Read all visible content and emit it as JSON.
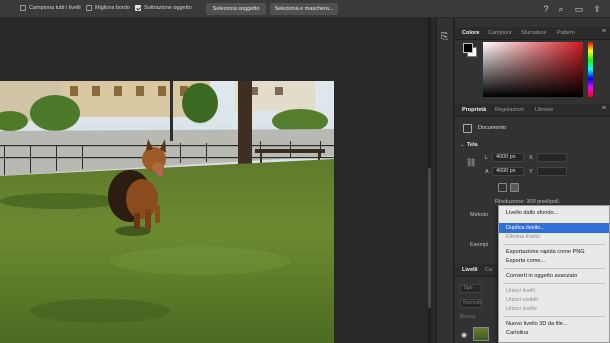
{
  "options_bar": {
    "sample_all_layers": "Campiona tutti i livelli",
    "enhance_edge": "Migliora bordo",
    "subtract_object": "Sottrazione oggetto",
    "select_subject": "Seleziona soggetto",
    "select_and_mask": "Seleziona e maschera..."
  },
  "color_panel": {
    "tabs": [
      "Colore",
      "Campioni",
      "Sfumature",
      "Pattern"
    ],
    "foreground": "#000000",
    "background": "#ffffff",
    "hue_color": "#d01a20"
  },
  "properties_panel": {
    "tabs": [
      "Proprietà",
      "Regolazioni",
      "Librerie"
    ],
    "document_label": "Documento",
    "canvas_section": "Tela",
    "width_label": "L",
    "width_value": "4000 px",
    "height_label": "A",
    "height_value": "4000 px",
    "x_label": "X",
    "y_label": "Y",
    "resolution": "Risoluzione: 300 pixel/poll.",
    "mode_label": "Metodo",
    "examples_label": "Esempi"
  },
  "layers_panel": {
    "tabs": [
      "Livelli",
      "Ca"
    ],
    "search_kind": "Tipo",
    "blend_mode": "Normale",
    "lock_label": "Blocca"
  },
  "context_menu": {
    "items": [
      {
        "label": "Livello dallo sfondo...",
        "state": "normal"
      },
      {
        "label": "Duplica livello...",
        "state": "highlighted"
      },
      {
        "label": "Elimina livello",
        "state": "disabled"
      },
      {
        "label": "Esportazione rapida come PNG",
        "state": "normal"
      },
      {
        "label": "Esporta come...",
        "state": "normal"
      },
      {
        "label": "Converti in oggetto avanzato",
        "state": "normal"
      },
      {
        "label": "Unisci livelli",
        "state": "disabled"
      },
      {
        "label": "Unisci visibili",
        "state": "disabled"
      },
      {
        "label": "Unisci livello",
        "state": "disabled"
      },
      {
        "label": "Nuovo livello 3D da file...",
        "state": "normal"
      },
      {
        "label": "Cartolina",
        "state": "normal"
      }
    ]
  },
  "toolbar_icons": [
    "help-icon",
    "search-icon",
    "workspace-icon",
    "share-icon"
  ]
}
